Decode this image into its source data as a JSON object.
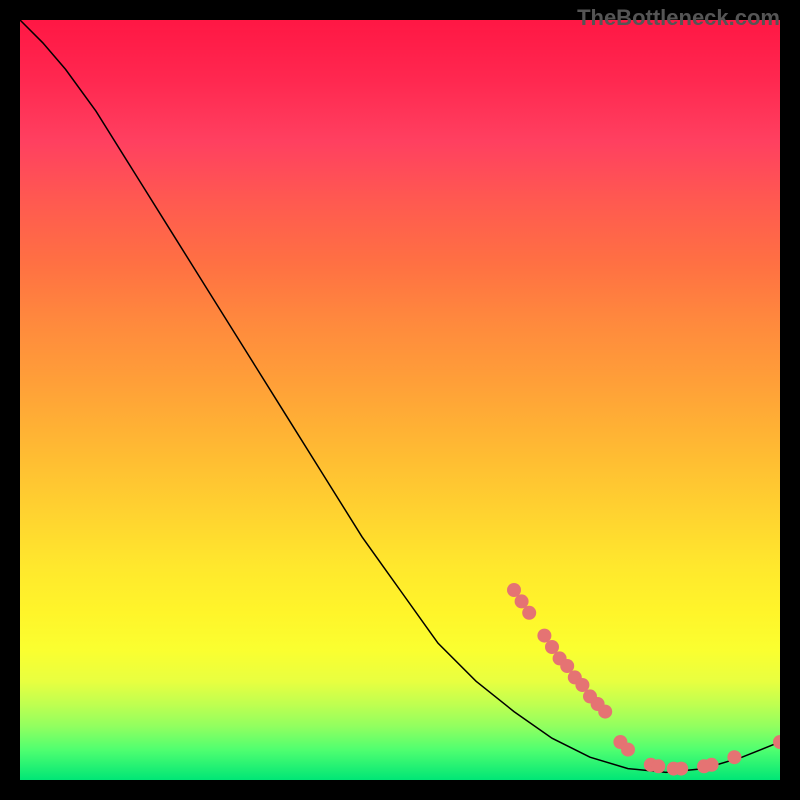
{
  "watermark": "TheBottleneck.com",
  "chart_data": {
    "type": "line",
    "title": "",
    "xlabel": "",
    "ylabel": "",
    "xlim": [
      0,
      100
    ],
    "ylim": [
      0,
      100
    ],
    "curve": [
      {
        "x": 0,
        "y": 100
      },
      {
        "x": 3,
        "y": 97
      },
      {
        "x": 6,
        "y": 93.5
      },
      {
        "x": 10,
        "y": 88
      },
      {
        "x": 15,
        "y": 80
      },
      {
        "x": 20,
        "y": 72
      },
      {
        "x": 25,
        "y": 64
      },
      {
        "x": 30,
        "y": 56
      },
      {
        "x": 35,
        "y": 48
      },
      {
        "x": 40,
        "y": 40
      },
      {
        "x": 45,
        "y": 32
      },
      {
        "x": 50,
        "y": 25
      },
      {
        "x": 55,
        "y": 18
      },
      {
        "x": 60,
        "y": 13
      },
      {
        "x": 65,
        "y": 9
      },
      {
        "x": 70,
        "y": 5.5
      },
      {
        "x": 75,
        "y": 3
      },
      {
        "x": 80,
        "y": 1.5
      },
      {
        "x": 85,
        "y": 1
      },
      {
        "x": 90,
        "y": 1.5
      },
      {
        "x": 95,
        "y": 3
      },
      {
        "x": 100,
        "y": 5
      }
    ],
    "dots": [
      {
        "x": 65,
        "y": 25
      },
      {
        "x": 66,
        "y": 23.5
      },
      {
        "x": 67,
        "y": 22
      },
      {
        "x": 69,
        "y": 19
      },
      {
        "x": 70,
        "y": 17.5
      },
      {
        "x": 71,
        "y": 16
      },
      {
        "x": 72,
        "y": 15
      },
      {
        "x": 73,
        "y": 13.5
      },
      {
        "x": 74,
        "y": 12.5
      },
      {
        "x": 75,
        "y": 11
      },
      {
        "x": 76,
        "y": 10
      },
      {
        "x": 77,
        "y": 9
      },
      {
        "x": 79,
        "y": 5
      },
      {
        "x": 80,
        "y": 4
      },
      {
        "x": 83,
        "y": 2
      },
      {
        "x": 84,
        "y": 1.8
      },
      {
        "x": 86,
        "y": 1.5
      },
      {
        "x": 87,
        "y": 1.5
      },
      {
        "x": 90,
        "y": 1.8
      },
      {
        "x": 91,
        "y": 2
      },
      {
        "x": 94,
        "y": 3
      },
      {
        "x": 100,
        "y": 5
      }
    ],
    "colors": {
      "curve": "#000000",
      "dots": "#e57373"
    }
  }
}
